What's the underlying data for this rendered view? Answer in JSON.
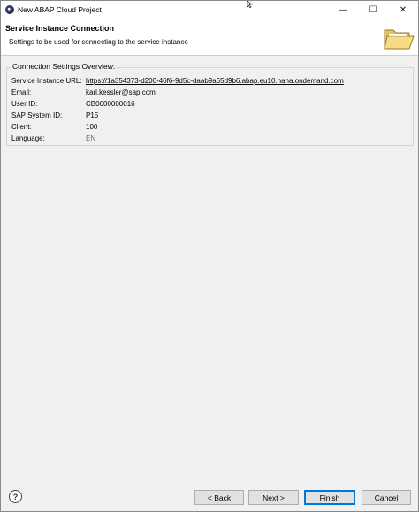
{
  "window": {
    "title": "New ABAP Cloud Project",
    "minimize": "—",
    "maximize": "☐",
    "close": "✕"
  },
  "banner": {
    "title": "Service Instance Connection",
    "subtitle": "Settings to be used for connecting to the service instance"
  },
  "group": {
    "label": "Connection Settings Overview:",
    "rows": [
      {
        "label": "Service Instance URL:",
        "value": "https://1a354373-d200-46f6-9d5c-daab9a65d9b6.abap.eu10.hana.ondemand.com"
      },
      {
        "label": "Email:",
        "value": "karl.kessler@sap.com"
      },
      {
        "label": "User ID:",
        "value": "CB0000000016"
      },
      {
        "label": "SAP System ID:",
        "value": "P15"
      },
      {
        "label": "Client:",
        "value": "100"
      },
      {
        "label": "Language:",
        "value": "EN"
      }
    ]
  },
  "buttons": {
    "help": "?",
    "back": "< Back",
    "next": "Next >",
    "finish": "Finish",
    "cancel": "Cancel"
  }
}
